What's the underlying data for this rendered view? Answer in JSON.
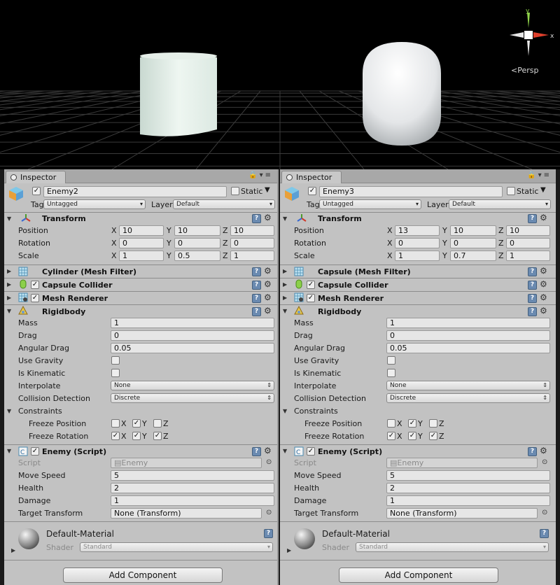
{
  "scene": {
    "persp_label": "Persp",
    "gizmo_axes": {
      "y": "y",
      "x": "x"
    }
  },
  "panels": [
    {
      "tab": "Inspector",
      "name": "Enemy2",
      "static_label": "Static",
      "tag_label": "Tag",
      "tag_value": "Untagged",
      "layer_label": "Layer",
      "layer_value": "Default",
      "transform": {
        "title": "Transform",
        "rows": [
          {
            "label": "Position",
            "x": "10",
            "y": "10",
            "z": "10"
          },
          {
            "label": "Rotation",
            "x": "0",
            "y": "0",
            "z": "0"
          },
          {
            "label": "Scale",
            "x": "1",
            "y": "0.5",
            "z": "1"
          }
        ]
      },
      "mesh_filter": "Cylinder (Mesh Filter)",
      "collider": "Capsule Collider",
      "renderer": "Mesh Renderer",
      "rigidbody": {
        "title": "Rigidbody",
        "mass_label": "Mass",
        "mass": "1",
        "drag_label": "Drag",
        "drag": "0",
        "angular_label": "Angular Drag",
        "angular": "0.05",
        "gravity_label": "Use Gravity",
        "kinematic_label": "Is Kinematic",
        "interpolate_label": "Interpolate",
        "interpolate": "None",
        "collision_label": "Collision Detection",
        "collision": "Discrete",
        "constraints_label": "Constraints",
        "freeze_pos_label": "Freeze Position",
        "freeze_rot_label": "Freeze Rotation"
      },
      "script": {
        "title": "Enemy (Script)",
        "script_label": "Script",
        "script_value": "Enemy",
        "speed_label": "Move Speed",
        "speed": "5",
        "health_label": "Health",
        "health": "2",
        "damage_label": "Damage",
        "damage": "1",
        "target_label": "Target Transform",
        "target": "None (Transform)"
      },
      "material": {
        "name": "Default-Material",
        "shader_label": "Shader",
        "shader": "Standard"
      },
      "add_component": "Add Component"
    },
    {
      "tab": "Inspector",
      "name": "Enemy3",
      "static_label": "Static",
      "tag_label": "Tag",
      "tag_value": "Untagged",
      "layer_label": "Layer",
      "layer_value": "Default",
      "transform": {
        "title": "Transform",
        "rows": [
          {
            "label": "Position",
            "x": "13",
            "y": "10",
            "z": "10"
          },
          {
            "label": "Rotation",
            "x": "0",
            "y": "0",
            "z": "0"
          },
          {
            "label": "Scale",
            "x": "1",
            "y": "0.7",
            "z": "1"
          }
        ]
      },
      "mesh_filter": "Capsule (Mesh Filter)",
      "collider": "Capsule Collider",
      "renderer": "Mesh Renderer",
      "rigidbody": {
        "title": "Rigidbody",
        "mass_label": "Mass",
        "mass": "1",
        "drag_label": "Drag",
        "drag": "0",
        "angular_label": "Angular Drag",
        "angular": "0.05",
        "gravity_label": "Use Gravity",
        "kinematic_label": "Is Kinematic",
        "interpolate_label": "Interpolate",
        "interpolate": "None",
        "collision_label": "Collision Detection",
        "collision": "Discrete",
        "constraints_label": "Constraints",
        "freeze_pos_label": "Freeze Position",
        "freeze_rot_label": "Freeze Rotation"
      },
      "script": {
        "title": "Enemy (Script)",
        "script_label": "Script",
        "script_value": "Enemy",
        "speed_label": "Move Speed",
        "speed": "5",
        "health_label": "Health",
        "health": "2",
        "damage_label": "Damage",
        "damage": "1",
        "target_label": "Target Transform",
        "target": "None (Transform)"
      },
      "material": {
        "name": "Default-Material",
        "shader_label": "Shader",
        "shader": "Standard"
      },
      "add_component": "Add Component"
    }
  ],
  "axis_labels": {
    "x": "X",
    "y": "Y",
    "z": "Z"
  },
  "colors": {
    "scene_bg": "#000000",
    "panel_bg": "#c2c2c2",
    "help_icon": "#6a8ab0"
  }
}
